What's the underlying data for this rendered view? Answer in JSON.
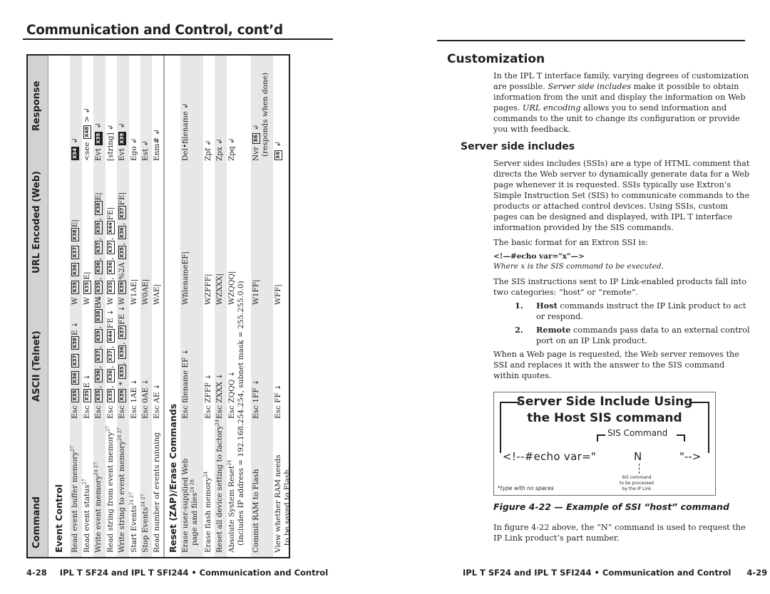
{
  "left_page": {
    "title": "Communication and Control, cont’d",
    "table": {
      "headers": [
        "Command",
        "ASCII (Telnet)",
        "URL Encoded (Web)",
        "Response"
      ],
      "sections": [
        {
          "title": "Event Control",
          "rows": [
            {
              "command": "Read event buffer memory",
              "sup": "27",
              "ascii": "Esc [X35] [X36] [X37] [X38]E ↵",
              "url": "W [X35] [X36] [X37] [X38]E|",
              "response": "[X54] ↲"
            },
            {
              "command": "Read event status",
              "sup": "27",
              "ascii": "Esc [X35]E ↵",
              "url": "W [X35]E|",
              "response": "<see [X48] > ↲"
            },
            {
              "command": "Write event memory",
              "sup": "24 27",
              "ascii": "Esc [X35], [X36], [X37], [X39], [X38]E ↵",
              "url": "W [X35], [X36], [X37], [X39], [X38]E|",
              "response": "Evt [X39] ↲"
            },
            {
              "command": "Read string from event memory",
              "sup": "27",
              "ascii": "Esc [X35], [X36], [X37], [X44]FE ↵",
              "url": "W [X35], [X36], [X37], [X44]FE|",
              "response": "[string] ↲"
            },
            {
              "command": "Write string to event memory",
              "sup": "24 27",
              "ascii": "Esc [X39] * [X35], [X36], [X37]FE ↵",
              "url": "W [X39]%2A [X35], [X36], [X37]FE|",
              "response": "Evt [X39] ↲"
            },
            {
              "command": "Start Events",
              "sup": "24 27",
              "ascii": "Esc 1AE ↵",
              "url": "W1AE|",
              "response": "Ego ↲"
            },
            {
              "command": "Stop Events",
              "sup": "24 27",
              "ascii": "Esc 0AE ↵",
              "url": "W0AE|",
              "response": "Est ↲"
            },
            {
              "command": "Read number of events running",
              "sup": "",
              "ascii": "Esc AE ↵",
              "url": "WAE|",
              "response": "Enm# ↲"
            }
          ]
        },
        {
          "title": "Reset (ZAP)/Erase Commands",
          "rows": [
            {
              "command": "Erase user-supplied Web",
              "command_line2": "page and files",
              "sup": "24 28",
              "ascii": "Esc filename EF ↵",
              "url": "WfilenameEF|",
              "response": "Del•filename ↲"
            },
            {
              "command": "Erase flash memory",
              "sup": "24",
              "ascii": "Esc ZFFF ↵",
              "url": "WZFFF|",
              "response": "Zpf ↲"
            },
            {
              "command": "Reset all device setting to factory",
              "sup": "24",
              "ascii": "Esc ZXXX ↵",
              "url": "WZXXX|",
              "response": "Zpx ↲"
            },
            {
              "command": "Absolute System Reset",
              "sup": "24",
              "ascii": "Esc ZQQQ ↵",
              "url": "WZQQQ|",
              "response": "Zpq ↲",
              "note": "(Includes IP address = 192.168.254.254, subnet mask = 255.255.0.0)"
            },
            {
              "command": "Commit RAM to Flash",
              "sup": "",
              "ascii": "Esc 1FF ↵",
              "url": "W1FF|",
              "response": "Nvr [X6] ↲",
              "response_line2": "(responds when done)"
            },
            {
              "command": "View whether RAM needs",
              "command_line2": "to be saved to Flash.",
              "sup": "",
              "ascii": "Esc FF ↵",
              "url": "WFF|",
              "response": "[X6] ↲"
            }
          ]
        }
      ]
    },
    "footer": {
      "page_number": "4-28",
      "text": "IPL T SF24 and IPL T SFI244 • Communication and Control"
    }
  },
  "right_page": {
    "heading": "Customization",
    "intro": {
      "part1": "In the IPL T interface family, varying degrees of customization are possible. ",
      "em1": "Server side includes",
      "part2": " make it possible to obtain information from the unit and display the information on Web pages. ",
      "em2": "URL encoding",
      "part3": " allows you to send information and commands to the unit to change its configuration or provide you with feedback."
    },
    "subheading": "Server side includes",
    "ssi_para": "Server sides includes (SSIs) are a type of HTML comment that directs the Web server to dynamically generate data for a Web page whenever it is requested. SSIs typically use Extron’s Simple Instruction Set (SIS) to communicate commands to the products or attached control devices. Using SSIs, custom pages can be designed and displayed, with IPL T interface information provided by the SIS commands.",
    "format_intro": "The basic format for an Extron SSI is:",
    "format_code": "<!—#echo var=\"x\"—>",
    "format_note": "Where x is the SIS command to be executed.",
    "categories_para": "The SIS instructions sent to IP Link-enabled products fall into two categories: “host” or “remote”.",
    "list": [
      {
        "num": "1.",
        "bold": "Host",
        "text": " commands instruct the IP Link product to act or respond."
      },
      {
        "num": "2.",
        "bold": "Remote",
        "text": " commands pass data to an external control port on an IP Link product."
      }
    ],
    "replace_para": "When a Web page is requested, the Web server removes the SSI and replaces it with the answer to the SIS command within quotes.",
    "figure": {
      "title_line1": "Server Side Include Using",
      "title_line2": "the Host SIS command",
      "sis_label": "SIS Command",
      "echo_open": "<!--#echo var=\"",
      "command": "N",
      "echo_close": "\"-->",
      "callout_line1": "SIS command",
      "callout_line2": "to be processed",
      "callout_line3": "by the IP Link",
      "note": "*type with no spaces"
    },
    "caption": "Figure 4-22 — Example of SSI “host” command",
    "closing_para": "In figure 4-22 above, the “N” command is used to request the IP Link product’s part number.",
    "footer": {
      "text": "IPL T SF24 and IPL T SFI244 • Communication and Control",
      "page_number": "4-29"
    }
  }
}
